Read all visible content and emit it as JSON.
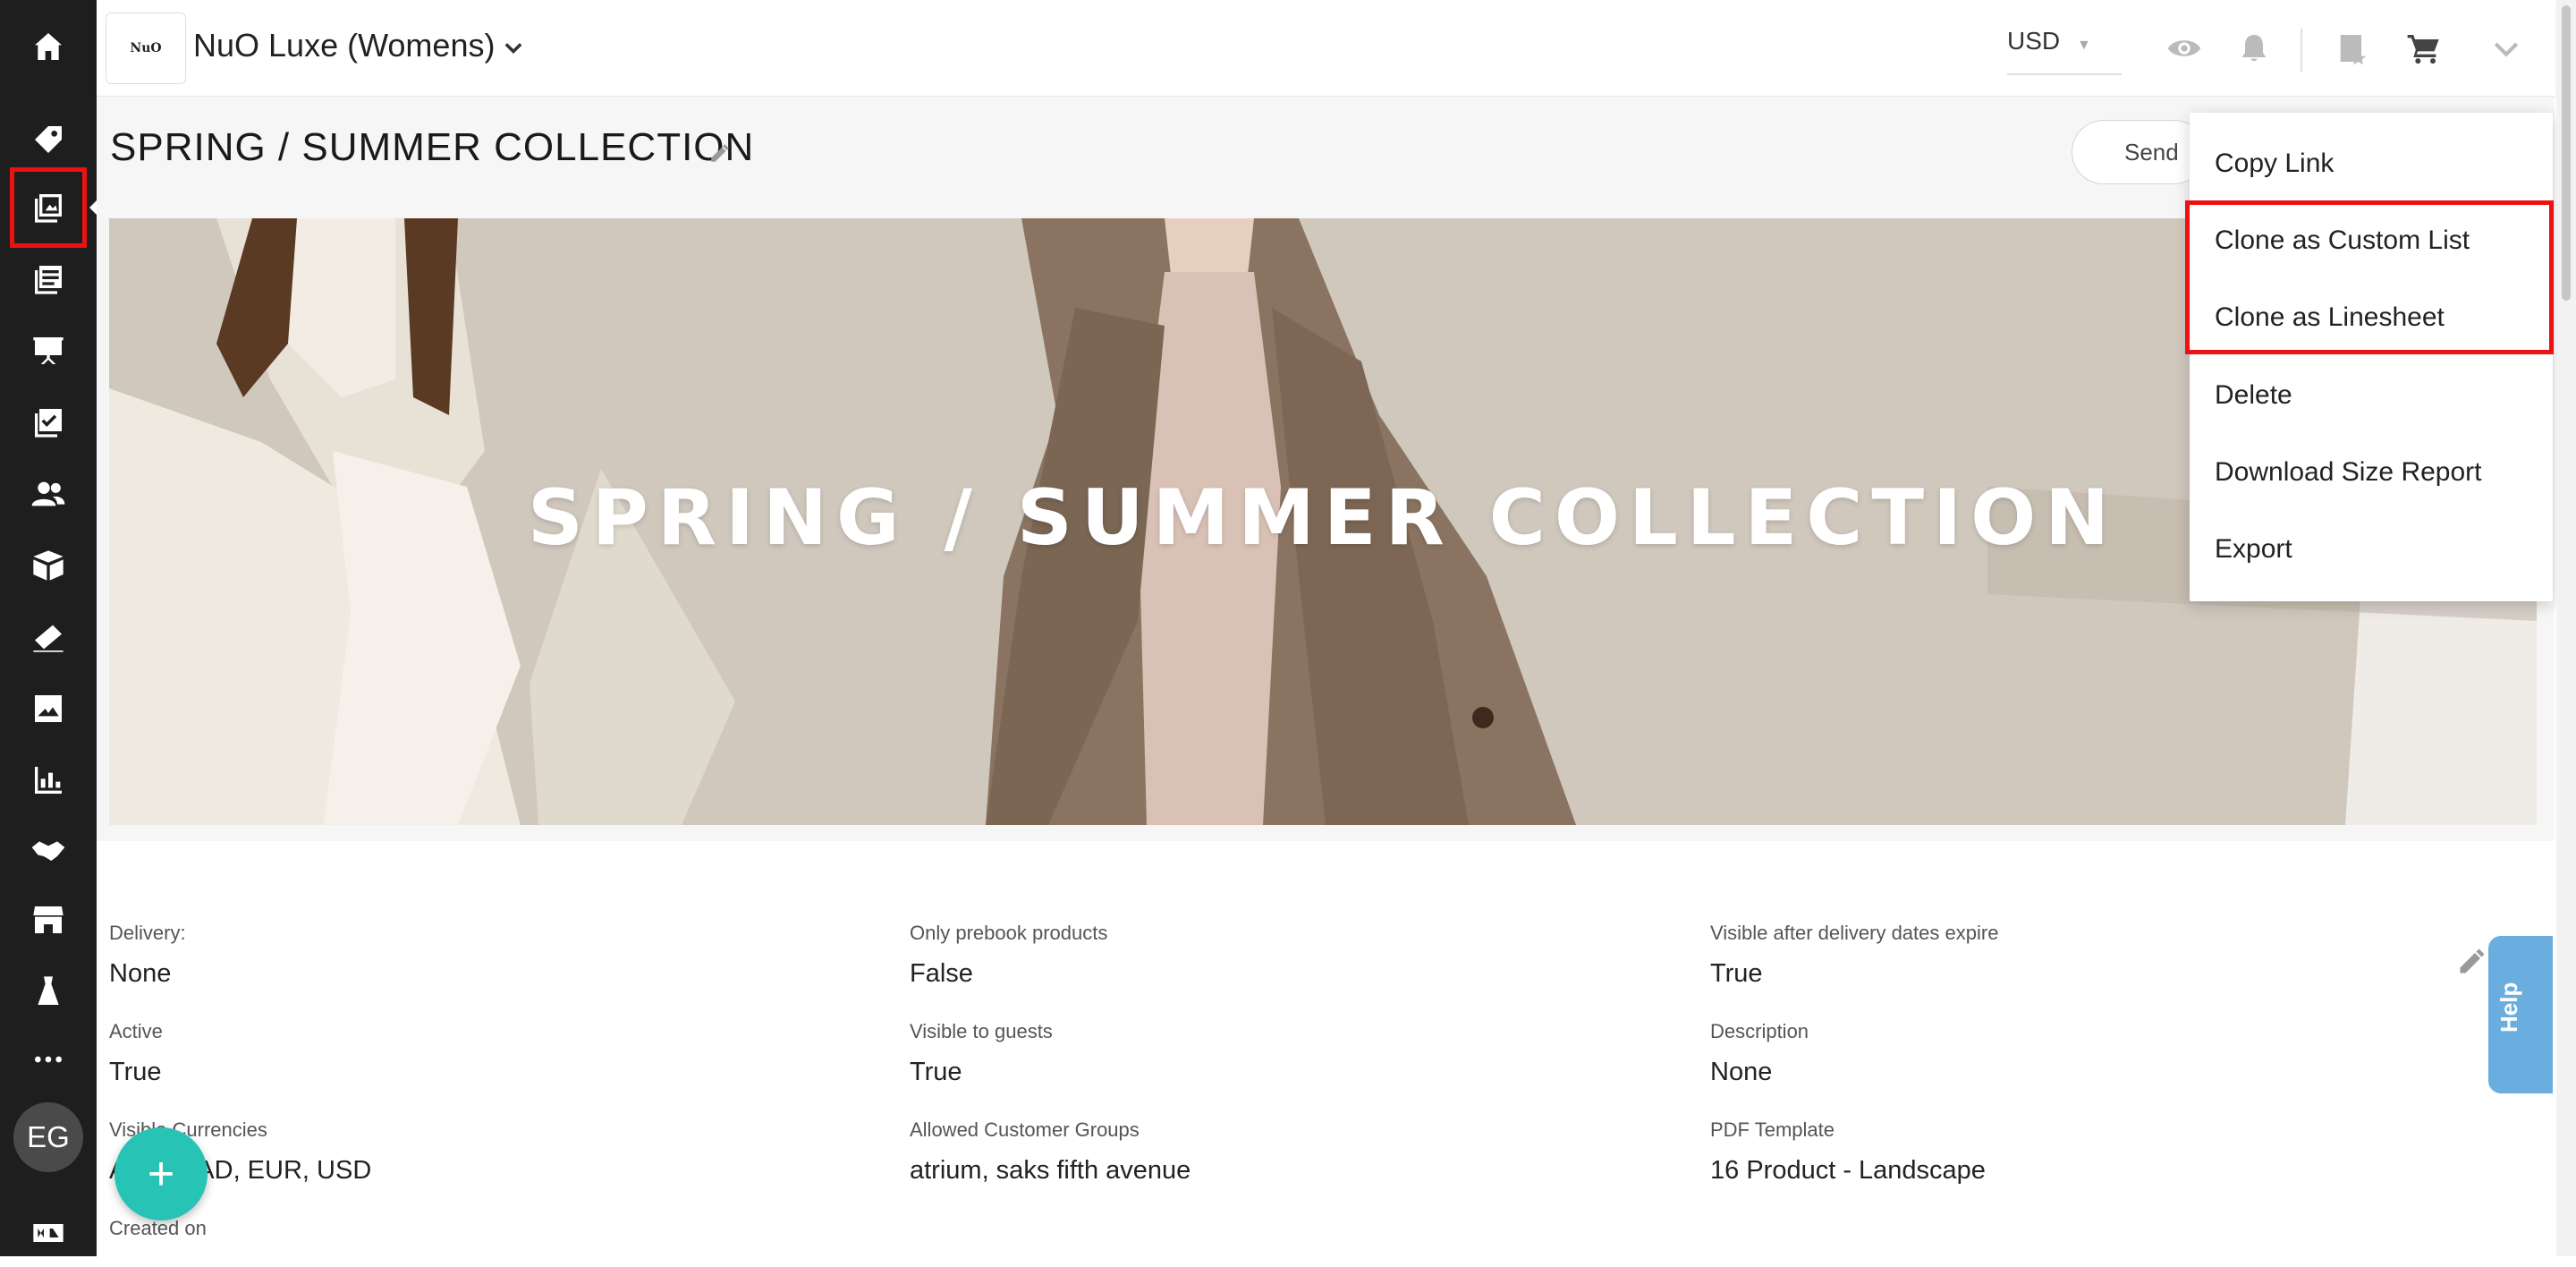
{
  "sidebar": {
    "icons": [
      "home-icon",
      "tag-icon",
      "catalog-icon",
      "linesheets-icon",
      "presentation-icon",
      "checklist-icon",
      "customers-icon",
      "box-icon",
      "orders-icon",
      "images-icon",
      "reports-icon",
      "handshake-icon",
      "storefront-icon",
      "dress-icon",
      "more-icon",
      "brand-logo-icon"
    ],
    "avatar_initials": "EG"
  },
  "header": {
    "brand_logo_text": "NuO",
    "brand_name": "NuO Luxe (Womens)",
    "currency": "USD"
  },
  "page": {
    "title": "SPRING / SUMMER COLLECTION",
    "send_label": "Send",
    "hero_title": "SPRING / SUMMER COLLECTION"
  },
  "dropdown": {
    "items": [
      "Copy Link",
      "Clone as Custom List",
      "Clone as Linesheet",
      "Delete",
      "Download Size Report",
      "Export"
    ]
  },
  "details": {
    "fields": [
      {
        "label": "Delivery:",
        "value": "None"
      },
      {
        "label": "Only prebook products",
        "value": "False"
      },
      {
        "label": "Visible after delivery dates expire",
        "value": "True"
      },
      {
        "label": "Active",
        "value": "True"
      },
      {
        "label": "Visible to guests",
        "value": "True"
      },
      {
        "label": "Description",
        "value": "None"
      },
      {
        "label": "Visible Currencies",
        "value": "AUD, CAD, EUR, USD"
      },
      {
        "label": "Allowed Customer Groups",
        "value": "atrium, saks fifth avenue"
      },
      {
        "label": "PDF Template",
        "value": "16 Product - Landscape"
      },
      {
        "label": "Created on",
        "value": ""
      }
    ]
  },
  "help": {
    "label": "Help"
  },
  "fab": {
    "label": "+"
  },
  "colors": {
    "sidebar": "#1e1e1e",
    "accent_fab": "#27c4b5",
    "help_tab": "#6aaee0",
    "highlight": "#ee1111"
  }
}
